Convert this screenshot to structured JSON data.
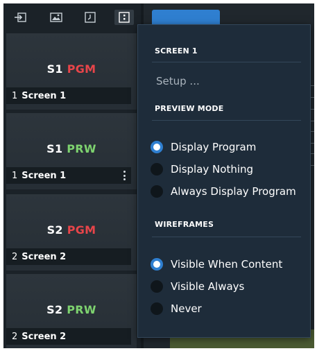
{
  "toolbar": {
    "icons": [
      "sign-in-icon",
      "image-icon",
      "clock-icon",
      "grid-icon"
    ],
    "active_index": 3
  },
  "thumbnails": [
    {
      "screen_code": "S1",
      "tag": "PGM",
      "tag_type": "program",
      "number": "1",
      "label": "Screen 1",
      "has_menu": false
    },
    {
      "screen_code": "S1",
      "tag": "PRW",
      "tag_type": "preview",
      "number": "1",
      "label": "Screen 1",
      "has_menu": true
    },
    {
      "screen_code": "S2",
      "tag": "PGM",
      "tag_type": "program",
      "number": "2",
      "label": "Screen 2",
      "has_menu": false
    },
    {
      "screen_code": "S2",
      "tag": "PRW",
      "tag_type": "preview",
      "number": "2",
      "label": "Screen 2",
      "has_menu": false
    }
  ],
  "colors": {
    "program_tag": "#e8454a",
    "preview_tag": "#7ed36f",
    "accent": "#2f7fd0",
    "menu_bg": "#1e2c3a"
  },
  "menu": {
    "screen_header": "SCREEN 1",
    "setup_label": "Setup ...",
    "preview_header": "PREVIEW MODE",
    "preview_options": [
      {
        "label": "Display Program",
        "selected": true
      },
      {
        "label": "Display Nothing",
        "selected": false
      },
      {
        "label": "Always Display Program",
        "selected": false
      }
    ],
    "wireframes_header": "WIREFRAMES",
    "wireframe_options": [
      {
        "label": "Visible When Content",
        "selected": true
      },
      {
        "label": "Visible Always",
        "selected": false
      },
      {
        "label": "Never",
        "selected": false
      }
    ]
  }
}
